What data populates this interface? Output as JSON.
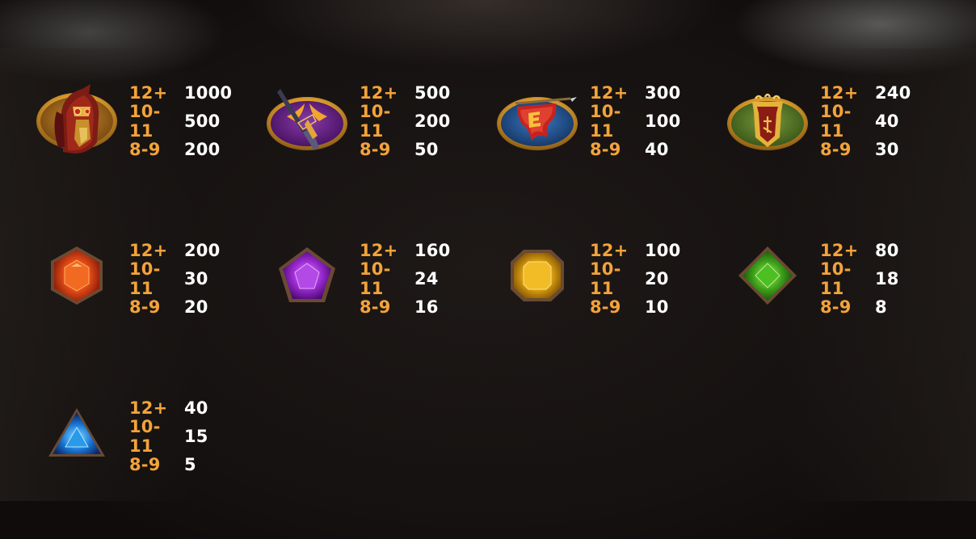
{
  "paytable": [
    {
      "symbol": "horse-icon",
      "pays": [
        {
          "range": "12+",
          "value": "1000"
        },
        {
          "range": "10-11",
          "value": "500"
        },
        {
          "range": "8-9",
          "value": "200"
        }
      ]
    },
    {
      "symbol": "halberd-icon",
      "pays": [
        {
          "range": "12+",
          "value": "500"
        },
        {
          "range": "10-11",
          "value": "200"
        },
        {
          "range": "8-9",
          "value": "50"
        }
      ]
    },
    {
      "symbol": "banner-icon",
      "pays": [
        {
          "range": "12+",
          "value": "300"
        },
        {
          "range": "10-11",
          "value": "100"
        },
        {
          "range": "8-9",
          "value": "40"
        }
      ]
    },
    {
      "symbol": "shield-icon",
      "pays": [
        {
          "range": "12+",
          "value": "240"
        },
        {
          "range": "10-11",
          "value": "40"
        },
        {
          "range": "8-9",
          "value": "30"
        }
      ]
    },
    {
      "symbol": "red-gem-icon",
      "pays": [
        {
          "range": "12+",
          "value": "200"
        },
        {
          "range": "10-11",
          "value": "30"
        },
        {
          "range": "8-9",
          "value": "20"
        }
      ]
    },
    {
      "symbol": "purple-gem-icon",
      "pays": [
        {
          "range": "12+",
          "value": "160"
        },
        {
          "range": "10-11",
          "value": "24"
        },
        {
          "range": "8-9",
          "value": "16"
        }
      ]
    },
    {
      "symbol": "yellow-gem-icon",
      "pays": [
        {
          "range": "12+",
          "value": "100"
        },
        {
          "range": "10-11",
          "value": "20"
        },
        {
          "range": "8-9",
          "value": "10"
        }
      ]
    },
    {
      "symbol": "green-gem-icon",
      "pays": [
        {
          "range": "12+",
          "value": "80"
        },
        {
          "range": "10-11",
          "value": "18"
        },
        {
          "range": "8-9",
          "value": "8"
        }
      ]
    },
    {
      "symbol": "blue-gem-icon",
      "pays": [
        {
          "range": "12+",
          "value": "40"
        },
        {
          "range": "10-11",
          "value": "15"
        },
        {
          "range": "8-9",
          "value": "5"
        }
      ]
    }
  ],
  "colors": {
    "range_text": "#f3a33a",
    "value_text": "#ffffff",
    "medallion_rim": "#e0a63a"
  }
}
